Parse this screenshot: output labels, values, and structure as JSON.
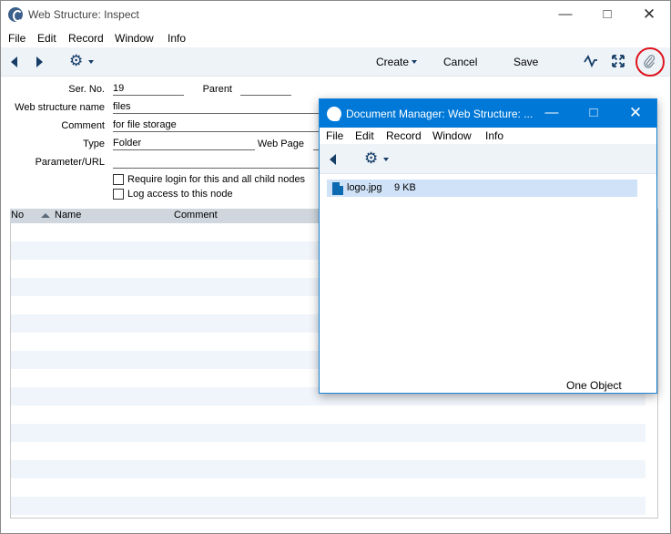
{
  "main": {
    "title": "Web Structure: Inspect",
    "menu": [
      "File",
      "Edit",
      "Record",
      "Window",
      "Info"
    ],
    "toolbar": {
      "create": "Create",
      "cancel": "Cancel",
      "save": "Save"
    },
    "form": {
      "ser_no_label": "Ser. No.",
      "ser_no_value": "19",
      "parent_label": "Parent",
      "parent_value": "",
      "name_label": "Web structure name",
      "name_value": "files",
      "comment_label": "Comment",
      "comment_value": "for file storage",
      "type_label": "Type",
      "type_value": "Folder",
      "webpage_label": "Web Page",
      "webpage_value": "",
      "param_label": "Parameter/URL",
      "param_value": "",
      "require_login_label": "Require login for this and all child nodes",
      "require_login_checked": false,
      "log_access_label": "Log access to this node",
      "log_access_checked": false
    },
    "table": {
      "columns": [
        "No",
        "Name",
        "Comment"
      ],
      "rows": []
    }
  },
  "doc_manager": {
    "title": "Document Manager: Web Structure: ...",
    "menu": [
      "File",
      "Edit",
      "Record",
      "Window",
      "Info"
    ],
    "files": [
      {
        "name": "logo.jpg",
        "size": "9 KB",
        "selected": true
      }
    ],
    "status": "One Object"
  },
  "colors": {
    "accent": "#0078d7",
    "toolbar_bg": "#eef3f8",
    "highlight_ring": "#e0141e",
    "selection": "#cfe2f7",
    "icon": "#153d66"
  },
  "icons": [
    "app-logo-icon",
    "back-icon",
    "forward-icon",
    "gear-icon",
    "activity-icon",
    "expand-icon",
    "paperclip-icon",
    "file-icon"
  ]
}
